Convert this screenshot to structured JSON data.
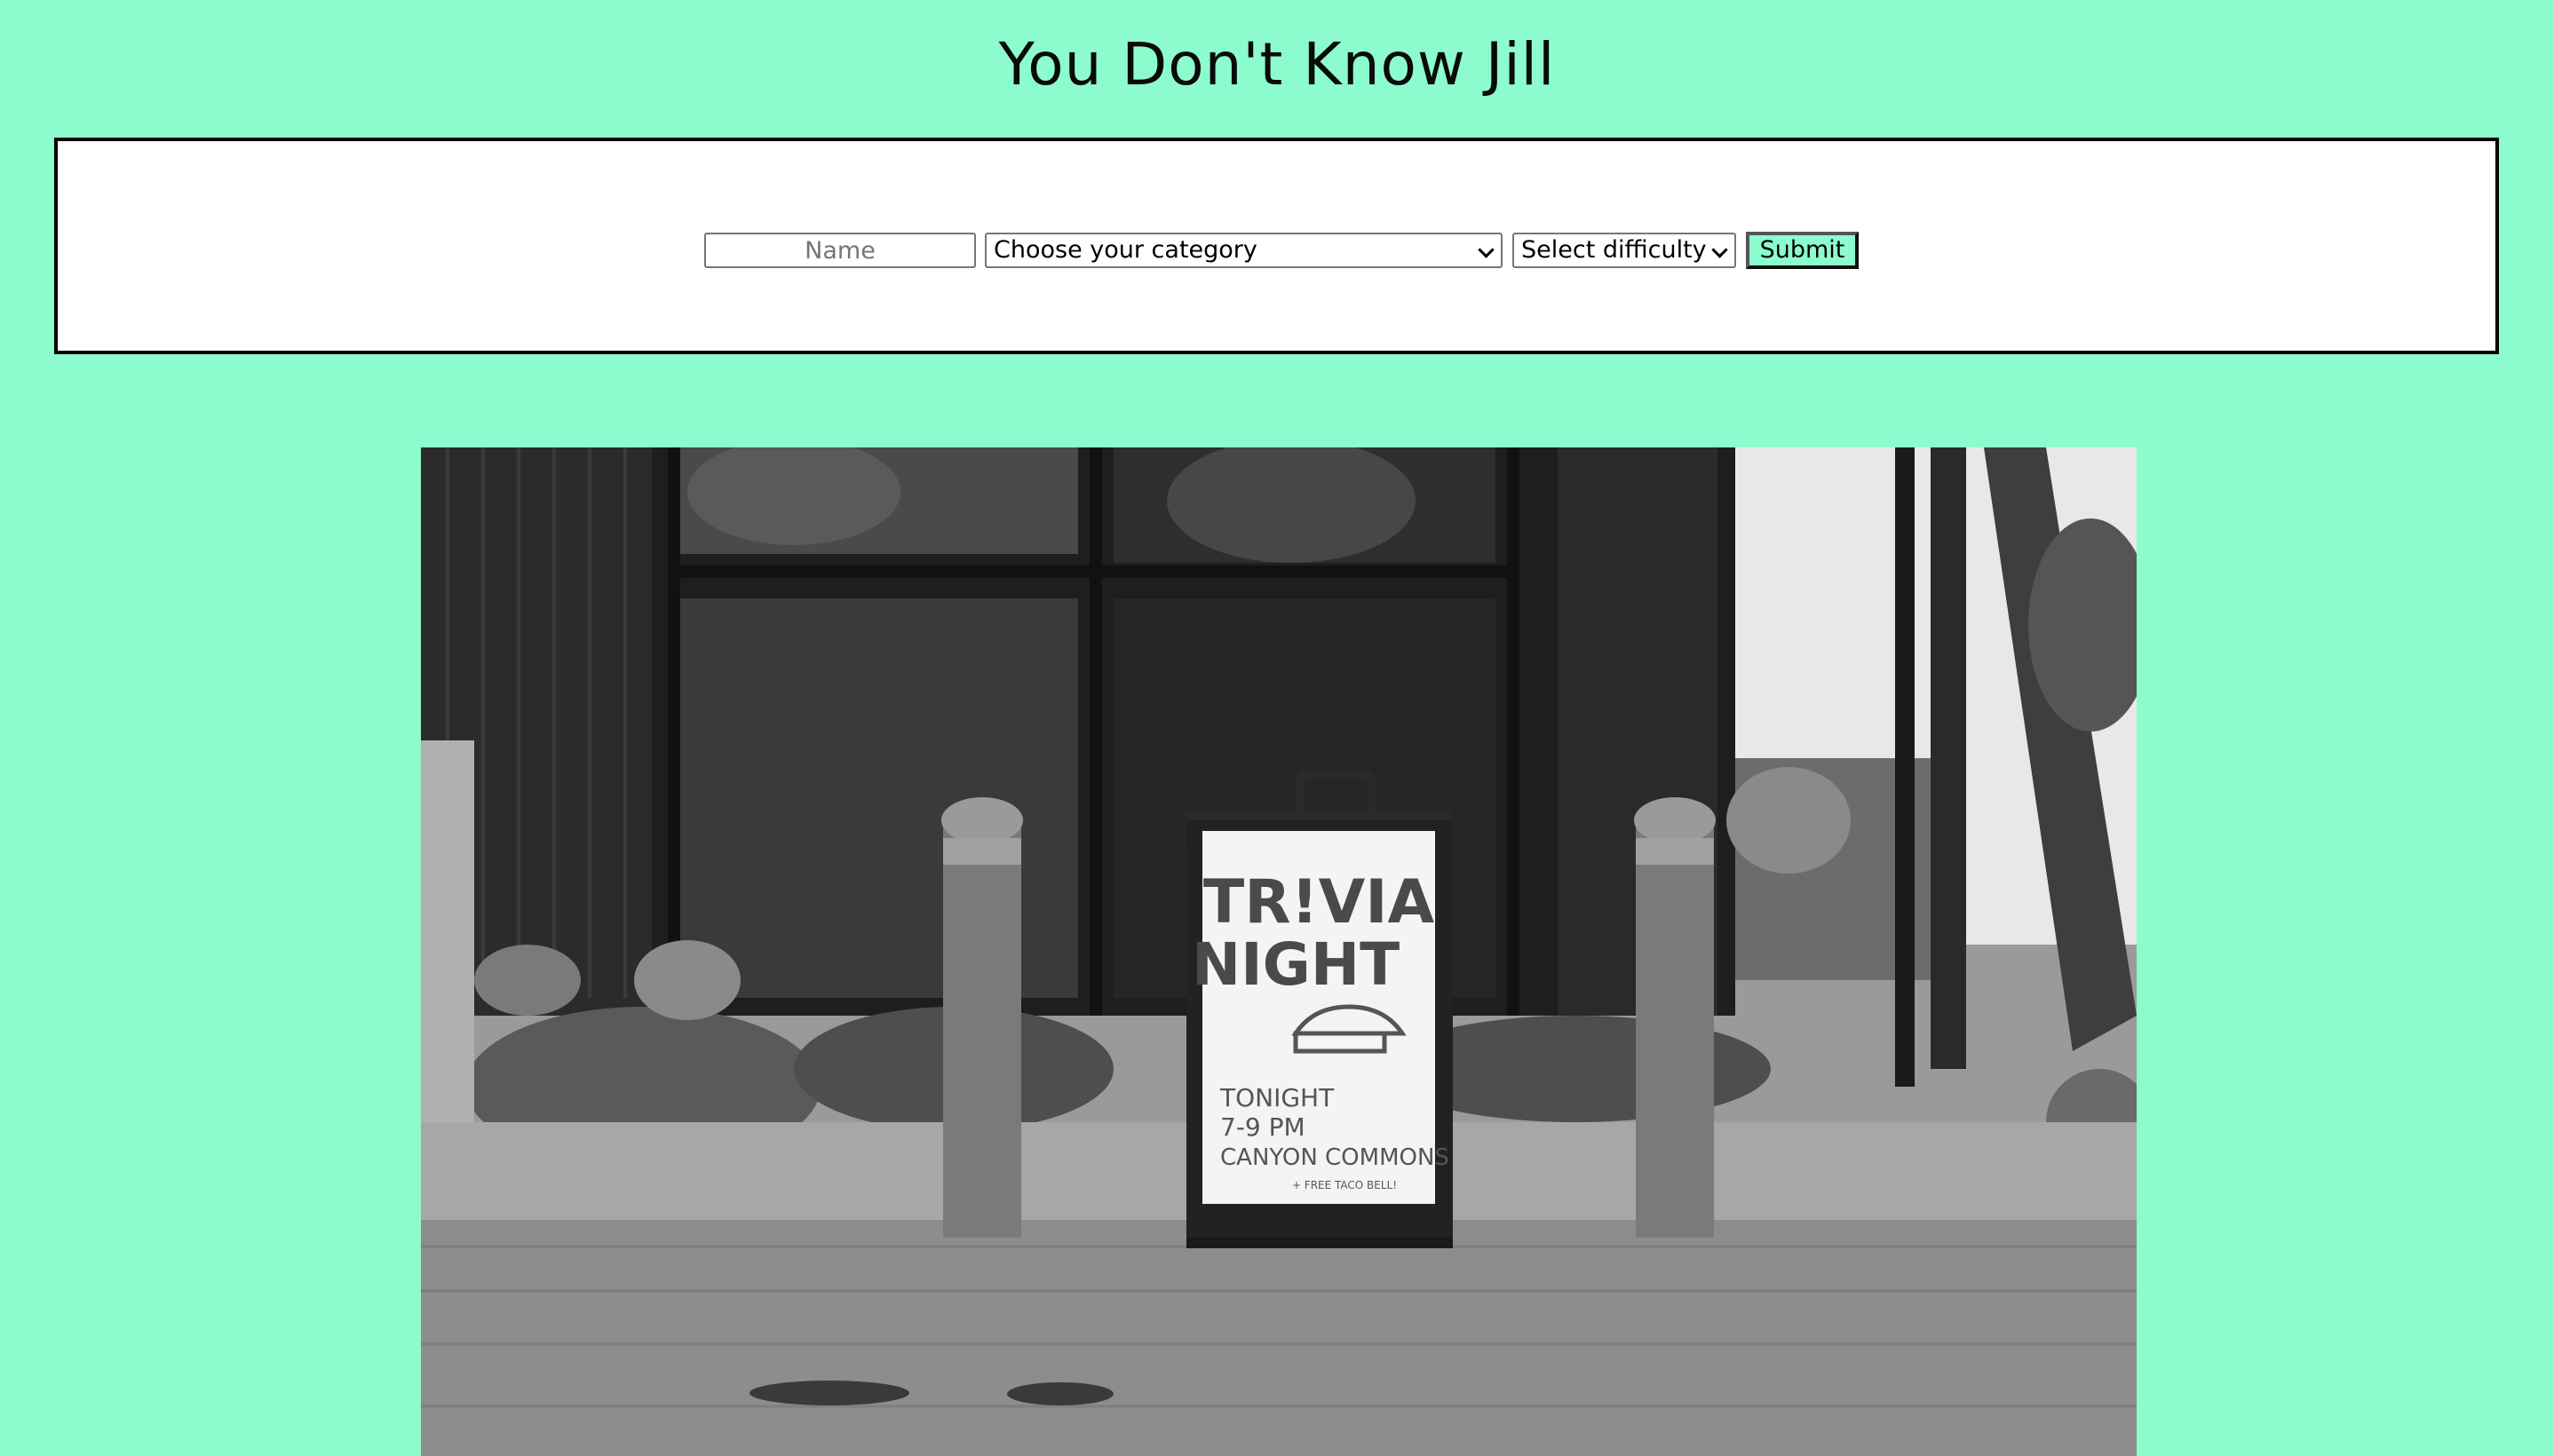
{
  "page": {
    "title": "You Don't Know Jill",
    "background_color": "#8cfccf"
  },
  "form": {
    "name_placeholder": "Name",
    "name_value": "",
    "category_selected": "Choose your category",
    "difficulty_selected": "Select difficulty",
    "submit_label": "Submit"
  },
  "hero_image": {
    "sign": {
      "line1": "TR!VIA",
      "line2": "NIGHT",
      "line3": "TONIGHT",
      "line4": "7-9 PM",
      "line5": "CANYON COMMONS",
      "line6": "+ FREE TACO BELL!"
    }
  }
}
